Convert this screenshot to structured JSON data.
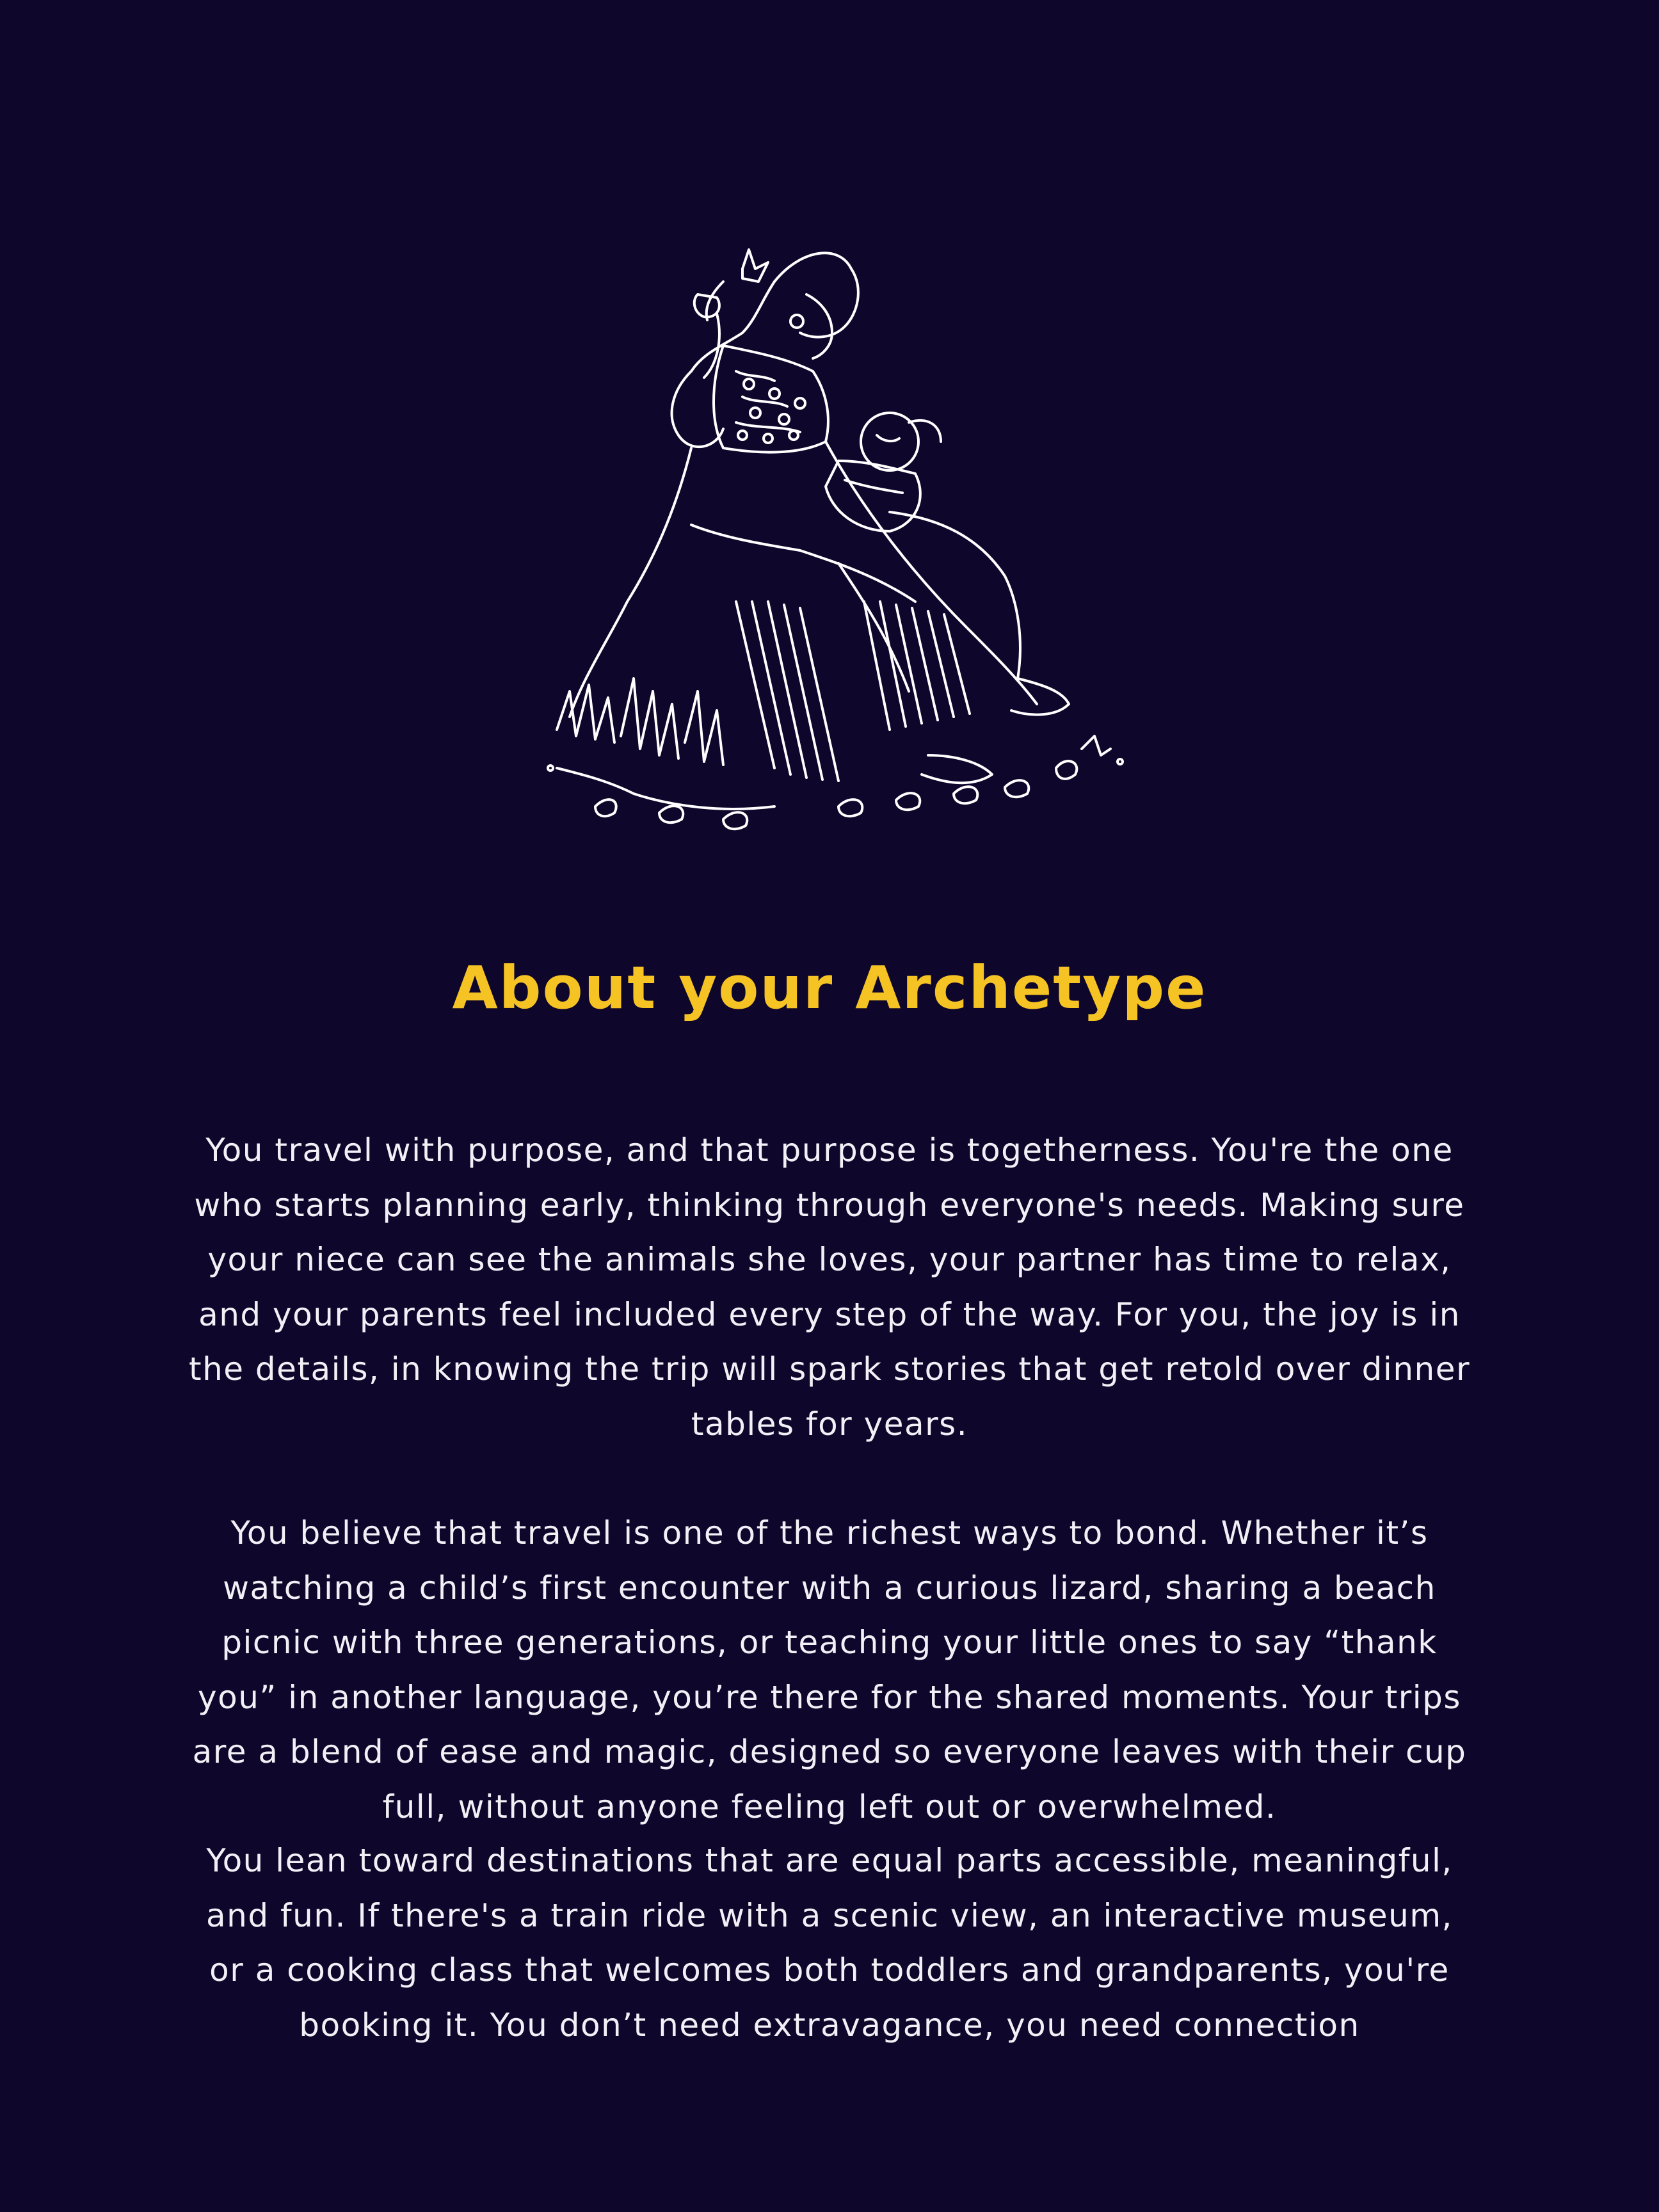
{
  "colors": {
    "background": "#0f062b",
    "heading": "#f6c324",
    "text": "#f2f0f6",
    "illustration_line": "#ffffff"
  },
  "illustration": {
    "icon": "mother-and-child-engraving",
    "description_kind": "line-art-illustration"
  },
  "heading": "About your Archetype",
  "paragraphs": [
    "You travel with purpose, and that purpose is togetherness. You're the one who starts planning early, thinking through everyone's needs. Making sure your niece can see the animals she loves, your partner has time to relax, and your parents feel included every step of the way. For you, the joy is in the details, in knowing the trip will spark stories that get retold over dinner tables for years.",
    "You believe that travel is one of the richest ways to bond. Whether it’s watching a child’s first encounter with a curious lizard, sharing a beach picnic with three generations, or teaching your little ones to say “thank you” in another language, you’re there for the shared moments. Your trips are a blend of ease and magic, designed so everyone leaves with their cup full, without anyone feeling left out or overwhelmed.",
    "You lean toward destinations that are equal parts accessible, meaningful, and fun. If there's a train ride with a scenic view, an interactive museum, or a cooking class that welcomes both toddlers and grandparents, you're booking it. You don’t need extravagance, you need connection"
  ]
}
